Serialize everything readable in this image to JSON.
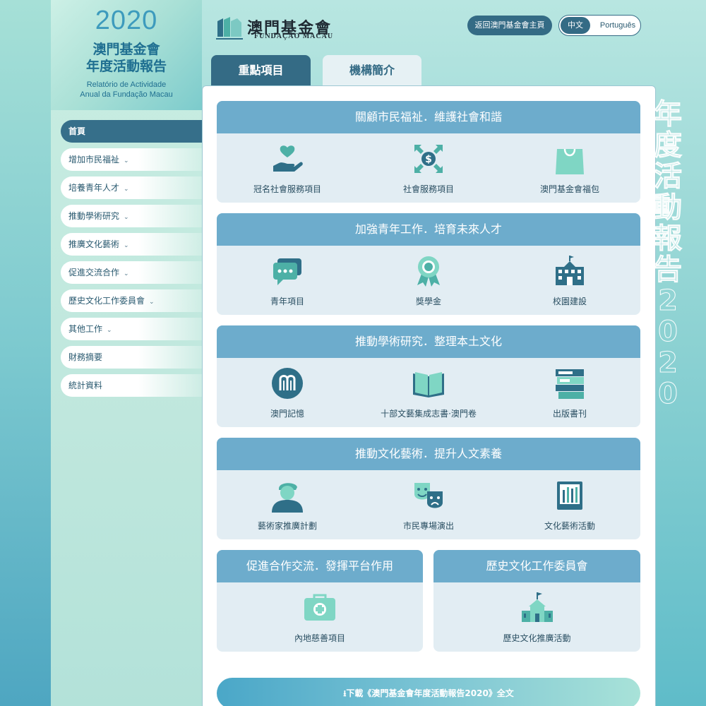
{
  "brand": {
    "year": "2020",
    "title_line1": "澳門基金會",
    "title_line2": "年度活動報告",
    "pt_line1": "Relatório de Actividade",
    "pt_line2": "Anual da Fundação Macau"
  },
  "logo": {
    "zh": "澳門基金會",
    "pt": "FUNDAÇÃO MACAU"
  },
  "header": {
    "home_button": "返回澳門基金會主頁",
    "lang_zh": "中文",
    "lang_pt": "Português"
  },
  "tabs": [
    {
      "label": "重點項目"
    },
    {
      "label": "機構簡介"
    }
  ],
  "nav": [
    {
      "label": "首頁"
    },
    {
      "label": "增加市民福祉"
    },
    {
      "label": "培養青年人才"
    },
    {
      "label": "推動學術研究"
    },
    {
      "label": "推廣文化藝術"
    },
    {
      "label": "促進交流合作"
    },
    {
      "label": "歷史文化工作委員會"
    },
    {
      "label": "其他工作"
    },
    {
      "label": "財務摘要"
    },
    {
      "label": "統計資料"
    }
  ],
  "vertical_text": "年度活動報告2020",
  "sections": [
    {
      "title": "關顧市民福祉．維護社會和諧",
      "items": [
        {
          "label": "冠名社會服務項目",
          "icon": "heart-hand-icon"
        },
        {
          "label": "社會服務項目",
          "icon": "dollar-arrows-icon"
        },
        {
          "label": "澳門基金會福包",
          "icon": "bag-icon"
        }
      ]
    },
    {
      "title": "加強青年工作．培育未來人才",
      "items": [
        {
          "label": "青年項目",
          "icon": "chat-icon"
        },
        {
          "label": "獎學金",
          "icon": "award-icon"
        },
        {
          "label": "校園建設",
          "icon": "school-icon"
        }
      ]
    },
    {
      "title": "推動學術研究．整理本土文化",
      "items": [
        {
          "label": "澳門記憶",
          "icon": "macau-memory-icon"
        },
        {
          "label": "十部文藝集成志書·澳門卷",
          "icon": "book-icon"
        },
        {
          "label": "出版書刊",
          "icon": "books-stack-icon"
        }
      ]
    },
    {
      "title": "推動文化藝術．提升人文素養",
      "items": [
        {
          "label": "藝術家推廣計劃",
          "icon": "artist-icon"
        },
        {
          "label": "市民專場演出",
          "icon": "theater-masks-icon"
        },
        {
          "label": "文化藝術活動",
          "icon": "brushes-icon"
        }
      ]
    },
    {
      "title": "促進合作交流．發揮平台作用",
      "items": [
        {
          "label": "內地慈善項目",
          "icon": "medical-kit-icon"
        }
      ]
    },
    {
      "title": "歷史文化工作委員會",
      "items": [
        {
          "label": "歷史文化推廣活動",
          "icon": "heritage-building-icon"
        }
      ]
    }
  ],
  "download": {
    "label": "下載《澳門基金會年度活動報告2020》全文"
  },
  "colors": {
    "primary": "#346b85",
    "section_head": "#6daccc",
    "icon": "#4db0a6",
    "icon_dark": "#2f6f88"
  }
}
